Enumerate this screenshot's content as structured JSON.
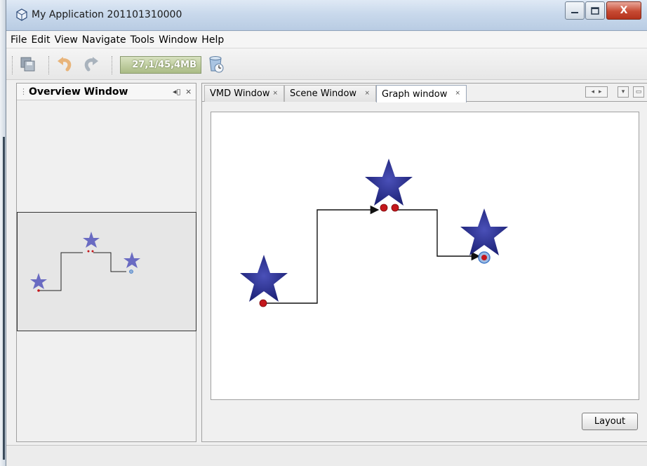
{
  "window": {
    "title": "My Application 201101310000",
    "controls": {
      "minimize": "–",
      "maximize": "□",
      "close": "X"
    }
  },
  "menu": {
    "items": [
      "File",
      "Edit",
      "View",
      "Navigate",
      "Tools",
      "Window",
      "Help"
    ]
  },
  "toolbar": {
    "buttons": [
      "save-all-icon",
      "undo-icon",
      "redo-icon"
    ],
    "memory": "27,1/45,4MB",
    "gc_icon": "garbage-collect-icon"
  },
  "overview": {
    "title": "Overview Window",
    "controls": {
      "minimize": "◂▯",
      "close": "⨯"
    }
  },
  "editor": {
    "tabs": [
      {
        "label": "VMD Window",
        "close": "⨯",
        "active": false
      },
      {
        "label": "Scene Window",
        "close": "⨯",
        "active": false
      },
      {
        "label": "Graph window",
        "close": "⨯",
        "active": true
      }
    ],
    "tab_nav": {
      "prev": "◂",
      "next": "▸",
      "list": "▾",
      "maximize": "▭"
    },
    "layout_button": "Layout"
  },
  "graph": {
    "nodes": [
      {
        "name": "node-1",
        "star_color": "#2a2f8c"
      },
      {
        "name": "node-2",
        "star_color": "#2a2f8c"
      },
      {
        "name": "node-3",
        "star_color": "#2a2f8c",
        "selected": true
      }
    ],
    "edges": [
      {
        "from": "node-1",
        "to": "node-2"
      },
      {
        "from": "node-2",
        "to": "node-3"
      }
    ],
    "pin_color": "#c4171c",
    "selection_color": "#3f78c8"
  }
}
